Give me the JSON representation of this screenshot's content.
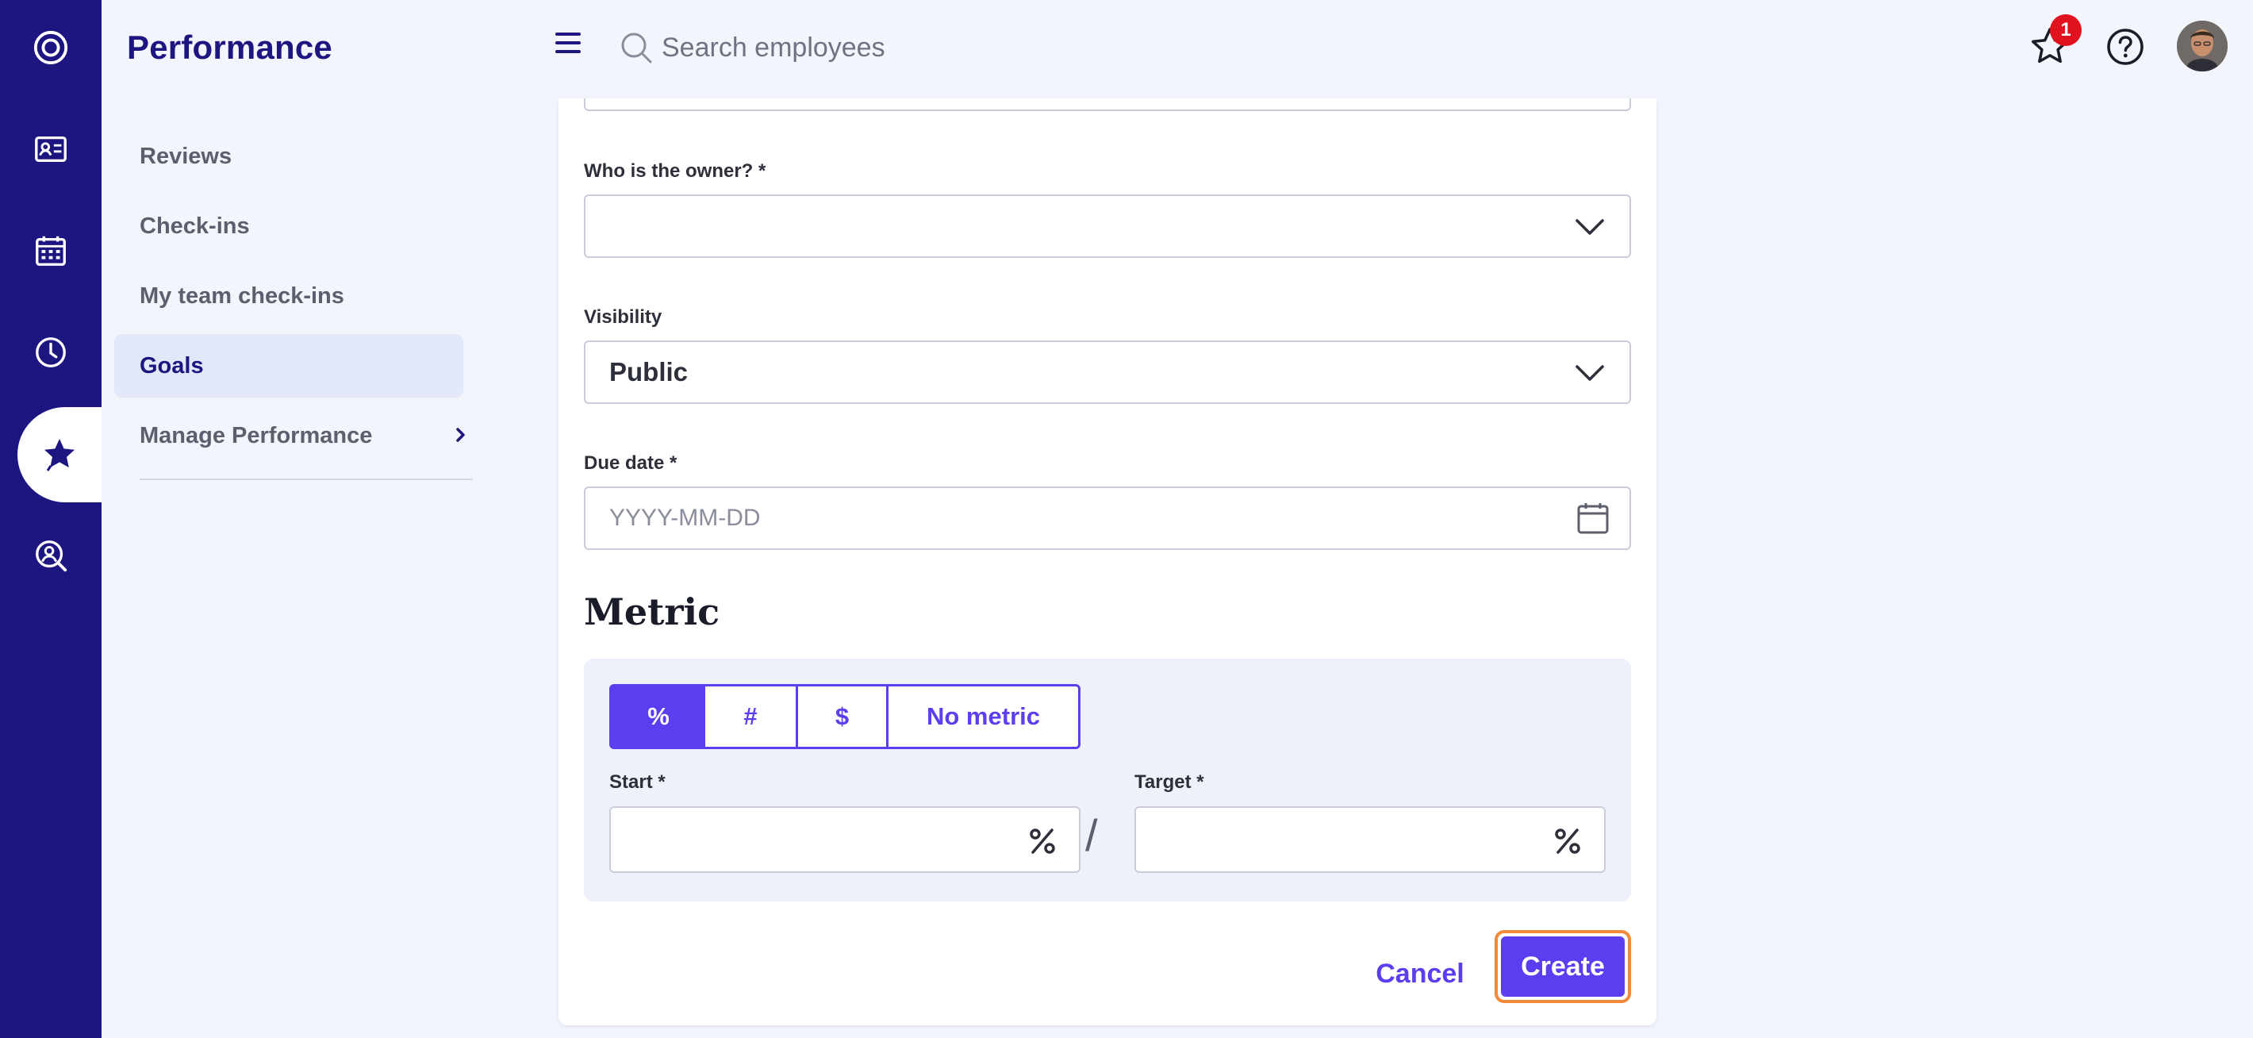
{
  "app": {
    "section_title": "Performance"
  },
  "rail": {
    "icons": [
      "logo-icon",
      "directory-icon",
      "calendar-icon",
      "clock-icon",
      "performance-star-icon",
      "recruiting-search-icon"
    ],
    "active": "performance-star-icon"
  },
  "subnav": {
    "items": [
      {
        "label": "Reviews",
        "active": false
      },
      {
        "label": "Check-ins",
        "active": false
      },
      {
        "label": "My team check-ins",
        "active": false
      },
      {
        "label": "Goals",
        "active": true
      },
      {
        "label": "Manage Performance",
        "active": false,
        "has_chevron": true
      }
    ]
  },
  "topbar": {
    "search_placeholder": "Search employees",
    "notification_count": "1"
  },
  "form": {
    "owner_label": "Who is the owner? *",
    "owner_value": "",
    "visibility_label": "Visibility",
    "visibility_value": "Public",
    "due_date_label": "Due date *",
    "due_date_placeholder": "YYYY-MM-DD",
    "metric_heading": "Metric",
    "metric_options": [
      "%",
      "#",
      "$",
      "No metric"
    ],
    "metric_selected": "%",
    "start_label": "Start *",
    "target_label": "Target *",
    "separator": "/",
    "cancel_label": "Cancel",
    "create_label": "Create"
  },
  "colors": {
    "rail_bg": "#1e1680",
    "accent": "#5b3ef0",
    "focus_ring": "#f28a3a",
    "badge": "#e0121e"
  }
}
